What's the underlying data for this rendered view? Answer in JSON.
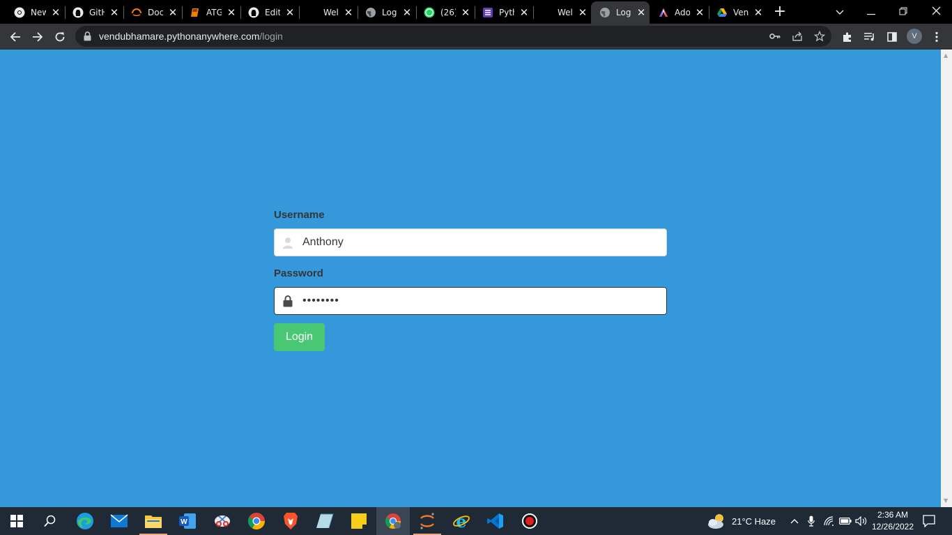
{
  "browser": {
    "tabs": [
      {
        "title": "New",
        "icon": "chrome-icon"
      },
      {
        "title": "GitH",
        "icon": "github-icon"
      },
      {
        "title": "Doc",
        "icon": "orange-ring-icon"
      },
      {
        "title": "ATG",
        "icon": "book-icon"
      },
      {
        "title": "Edit",
        "icon": "github-icon"
      },
      {
        "title": "Wel",
        "icon": "none"
      },
      {
        "title": "Log",
        "icon": "globe-icon"
      },
      {
        "title": "(26)",
        "icon": "whatsapp-icon"
      },
      {
        "title": "Pyth",
        "icon": "form-icon"
      },
      {
        "title": "Wel",
        "icon": "none"
      },
      {
        "title": "Log",
        "icon": "globe-icon",
        "active": true
      },
      {
        "title": "Ado",
        "icon": "adobe-icon"
      },
      {
        "title": "Ven",
        "icon": "drive-icon"
      }
    ],
    "url_host": "vendubhamare.pythonanywhere.com",
    "url_path": "/login",
    "profile_initial": "V"
  },
  "form": {
    "username_label": "Username",
    "username_value": "Anthony",
    "password_label": "Password",
    "password_value": "••••••••",
    "login_label": "Login"
  },
  "taskbar": {
    "weather": "21°C  Haze",
    "time": "2:36 AM",
    "date": "12/26/2022"
  },
  "colors": {
    "page_bg": "#3498db",
    "button": "#48c774",
    "label": "#363636"
  }
}
